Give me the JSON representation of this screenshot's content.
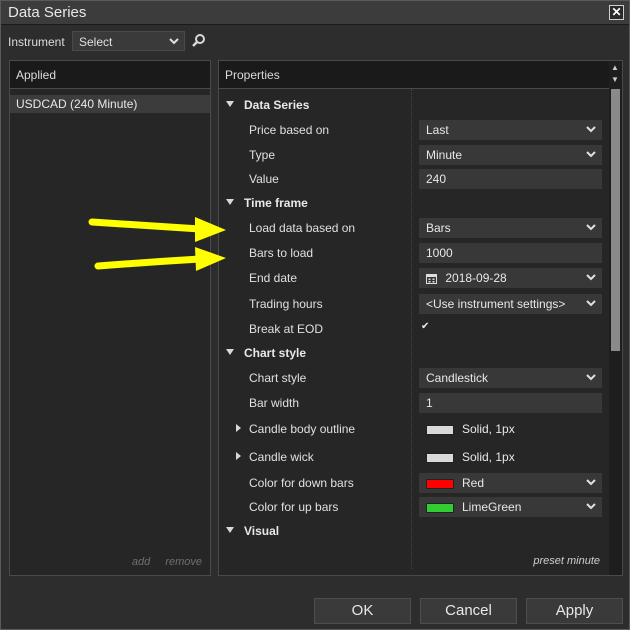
{
  "window": {
    "title": "Data Series"
  },
  "instrument": {
    "label": "Instrument",
    "value": "Select"
  },
  "applied": {
    "header": "Applied",
    "items": [
      "USDCAD (240 Minute)"
    ],
    "add_label": "add",
    "remove_label": "remove"
  },
  "properties": {
    "header": "Properties",
    "preset_label": "preset minute",
    "categories": [
      {
        "name": "Data Series",
        "rows": [
          {
            "label": "Price based on",
            "value": "Last",
            "dropdown": true
          },
          {
            "label": "Type",
            "value": "Minute",
            "dropdown": true
          },
          {
            "label": "Value",
            "value": "240",
            "dropdown": false
          }
        ]
      },
      {
        "name": "Time frame",
        "rows": [
          {
            "label": "Load data based on",
            "value": "Bars",
            "dropdown": true
          },
          {
            "label": "Bars to load",
            "value": "1000",
            "dropdown": false
          },
          {
            "label": "End date",
            "value": "2018-09-28",
            "dropdown": true,
            "icon": "calendar-icon"
          },
          {
            "label": "Trading hours",
            "value": "<Use instrument settings>",
            "dropdown": true
          },
          {
            "label": "Break at EOD",
            "checked": true
          }
        ]
      },
      {
        "name": "Chart style",
        "rows": [
          {
            "label": "Chart style",
            "value": "Candlestick",
            "dropdown": true
          },
          {
            "label": "Bar width",
            "value": "1",
            "dropdown": false
          },
          {
            "label": "Candle body outline",
            "value": "Solid, 1px",
            "swatch": "#d9d9d9",
            "expandable": true
          },
          {
            "label": "Candle wick",
            "value": "Solid, 1px",
            "swatch": "#d9d9d9",
            "expandable": true
          },
          {
            "label": "Color for down bars",
            "value": "Red",
            "swatch": "#ff0000",
            "dropdown": true
          },
          {
            "label": "Color for up bars",
            "value": "LimeGreen",
            "swatch": "#32cd32",
            "dropdown": true
          }
        ]
      },
      {
        "name": "Visual",
        "rows": []
      }
    ]
  },
  "buttons": {
    "ok": "OK",
    "cancel": "Cancel",
    "apply": "Apply"
  },
  "colors": {
    "arrow": "#ffff00",
    "background": "#2d2d2d",
    "panel": "#262626"
  }
}
